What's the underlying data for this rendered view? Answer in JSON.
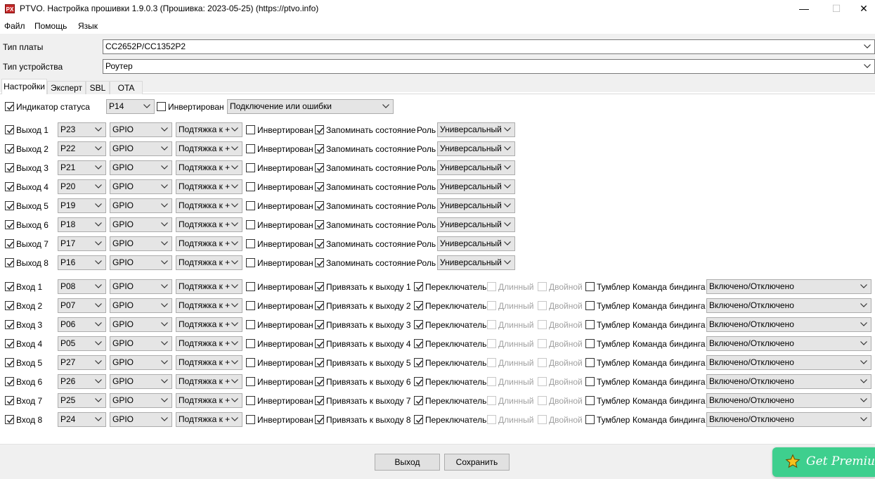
{
  "window": {
    "title": "PTVO. Настройка прошивки 1.9.0.3 (Прошивка: 2023-05-25) (https://ptvo.info)",
    "icon_text": "PX",
    "min_glyph": "—",
    "max_glyph": "☐",
    "close_glyph": "✕"
  },
  "menu": [
    "Файл",
    "Помощь",
    "Язык"
  ],
  "board": {
    "label": "Тип платы",
    "value": "CC2652P/CC1352P2"
  },
  "device": {
    "label": "Тип устройства",
    "value": "Роутер"
  },
  "tabs": [
    {
      "label": "Настройки",
      "active": true
    },
    {
      "label": "Эксперт",
      "active": false
    },
    {
      "label": "SBL",
      "active": false
    },
    {
      "label": "OTA",
      "active": false
    }
  ],
  "status": {
    "checked": true,
    "label": "Индикатор статуса",
    "pin": "P14",
    "inverted_checked": false,
    "inverted_label": "Инвертирован",
    "mode": "Подключение или ошибки"
  },
  "labels": {
    "inverted": "Инвертирован",
    "remember": "Запоминать состояние",
    "role": "Роль",
    "switch": "Переключатель",
    "long": "Длинный",
    "double": "Двойной",
    "toggle": "Тумблер",
    "binding_cmd": "Команда биндинга"
  },
  "outputs": [
    {
      "label": "Выход 1",
      "pin": "P23",
      "mode": "GPIO",
      "pull": "Подтяжка к +",
      "role": "Универсальный"
    },
    {
      "label": "Выход 2",
      "pin": "P22",
      "mode": "GPIO",
      "pull": "Подтяжка к +",
      "role": "Универсальный"
    },
    {
      "label": "Выход 3",
      "pin": "P21",
      "mode": "GPIO",
      "pull": "Подтяжка к +",
      "role": "Универсальный"
    },
    {
      "label": "Выход 4",
      "pin": "P20",
      "mode": "GPIO",
      "pull": "Подтяжка к +",
      "role": "Универсальный"
    },
    {
      "label": "Выход 5",
      "pin": "P19",
      "mode": "GPIO",
      "pull": "Подтяжка к +",
      "role": "Универсальный"
    },
    {
      "label": "Выход 6",
      "pin": "P18",
      "mode": "GPIO",
      "pull": "Подтяжка к +",
      "role": "Универсальный"
    },
    {
      "label": "Выход 7",
      "pin": "P17",
      "mode": "GPIO",
      "pull": "Подтяжка к +",
      "role": "Универсальный"
    },
    {
      "label": "Выход 8",
      "pin": "P16",
      "mode": "GPIO",
      "pull": "Подтяжка к +",
      "role": "Универсальный"
    }
  ],
  "inputs": [
    {
      "label": "Вход 1",
      "pin": "P08",
      "mode": "GPIO",
      "pull": "Подтяжка к +",
      "bind": "Привязать к выходу 1",
      "cmd": "Включено/Отключено"
    },
    {
      "label": "Вход 2",
      "pin": "P07",
      "mode": "GPIO",
      "pull": "Подтяжка к +",
      "bind": "Привязать к выходу 2",
      "cmd": "Включено/Отключено"
    },
    {
      "label": "Вход 3",
      "pin": "P06",
      "mode": "GPIO",
      "pull": "Подтяжка к +",
      "bind": "Привязать к выходу 3",
      "cmd": "Включено/Отключено"
    },
    {
      "label": "Вход 4",
      "pin": "P05",
      "mode": "GPIO",
      "pull": "Подтяжка к +",
      "bind": "Привязать к выходу 4",
      "cmd": "Включено/Отключено"
    },
    {
      "label": "Вход 5",
      "pin": "P27",
      "mode": "GPIO",
      "pull": "Подтяжка к +",
      "bind": "Привязать к выходу 5",
      "cmd": "Включено/Отключено"
    },
    {
      "label": "Вход 6",
      "pin": "P26",
      "mode": "GPIO",
      "pull": "Подтяжка к +",
      "bind": "Привязать к выходу 6",
      "cmd": "Включено/Отключено"
    },
    {
      "label": "Вход 7",
      "pin": "P25",
      "mode": "GPIO",
      "pull": "Подтяжка к +",
      "bind": "Привязать к выходу 7",
      "cmd": "Включено/Отключено"
    },
    {
      "label": "Вход 8",
      "pin": "P24",
      "mode": "GPIO",
      "pull": "Подтяжка к +",
      "bind": "Привязать к выходу 8",
      "cmd": "Включено/Отключено"
    }
  ],
  "buttons": {
    "exit": "Выход",
    "save": "Сохранить"
  },
  "premium": {
    "label": "Get Premium",
    "color": "#3ecf8e",
    "icon": "star-icon"
  }
}
